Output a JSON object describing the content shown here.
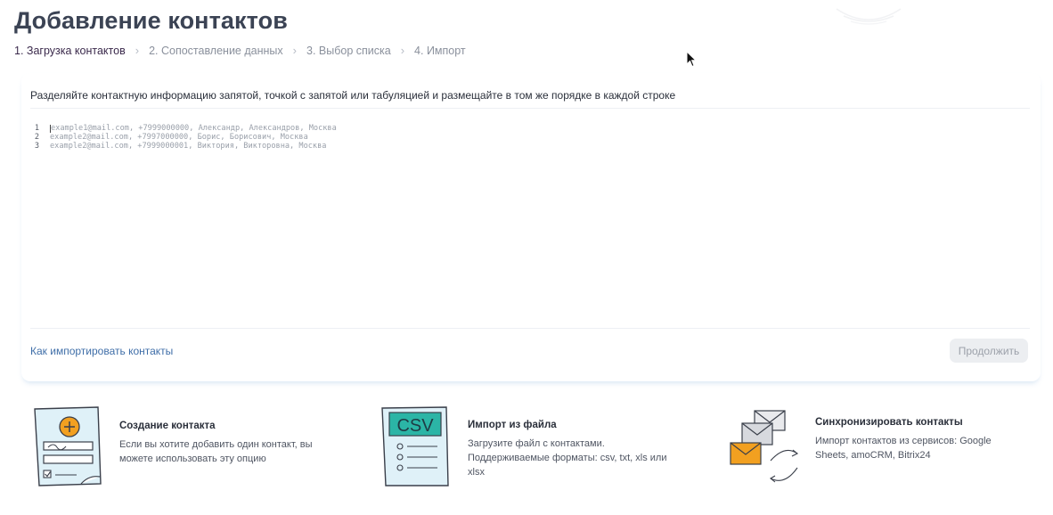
{
  "page": {
    "title": "Добавление контактов"
  },
  "steps": [
    {
      "label": "1. Загрузка контактов",
      "active": true
    },
    {
      "label": "2. Сопоставление данных",
      "active": false
    },
    {
      "label": "3. Выбор списка",
      "active": false
    },
    {
      "label": "4. Импорт",
      "active": false
    }
  ],
  "step_separator": "›",
  "editor": {
    "hint": "Разделяйте контактную информацию запятой, точкой с запятой или табуляцией и размещайте в том же порядке в каждой строке",
    "placeholder_lines": [
      {
        "num": "1",
        "text": "example1@mail.com, +7999000000, Александр, Александров, Москва"
      },
      {
        "num": "2",
        "text": "example2@mail.com, +7997000000, Борис, Борисович, Москва"
      },
      {
        "num": "3",
        "text": "example2@mail.com, +7999000001, Виктория, Викторовна, Москва"
      }
    ]
  },
  "footer": {
    "help_link": "Как импортировать контакты",
    "continue_label": "Продолжить"
  },
  "options": [
    {
      "title": "Создание контакта",
      "description": "Если вы хотите добавить один контакт, вы можете использовать эту опцию",
      "icon": "contact-form-icon"
    },
    {
      "title": "Импорт из файла",
      "description": "Загрузите файл с контактами. Поддерживаемые форматы: csv, txt, xls или xlsx",
      "icon": "csv-file-icon",
      "icon_text": "CSV"
    },
    {
      "title": "Синхронизировать контакты",
      "description": "Импорт контактов из сервисов: Google Sheets, amoCRM, Bitrix24",
      "icon": "envelopes-sync-icon"
    }
  ],
  "colors": {
    "accent_orange": "#f2a020",
    "csv_teal": "#2bb5a6",
    "illustration_bg": "#dff1f8",
    "link_blue": "#3f6ea8"
  }
}
